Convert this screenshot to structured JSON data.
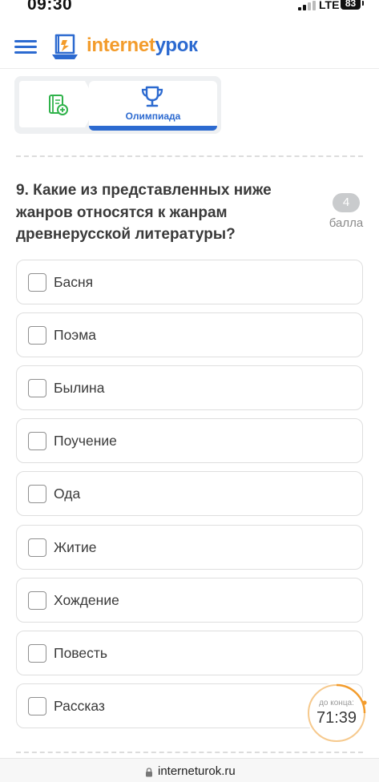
{
  "status_bar": {
    "time": "09:30",
    "network": "LTE",
    "battery": "83"
  },
  "header": {
    "logo_part1": "internet",
    "logo_part2": "урок"
  },
  "steps": {
    "active_label": "Олимпиада"
  },
  "question": {
    "text": "9. Какие из представленных ниже жанров относятся к жанрам древнерусской литературы?",
    "points_value": "4",
    "points_label": "балла"
  },
  "options": [
    {
      "label": "Басня",
      "checked": false
    },
    {
      "label": "Поэма",
      "checked": false
    },
    {
      "label": "Былина",
      "checked": false
    },
    {
      "label": "Поучение",
      "checked": false
    },
    {
      "label": "Ода",
      "checked": false
    },
    {
      "label": "Житие",
      "checked": false
    },
    {
      "label": "Хождение",
      "checked": false
    },
    {
      "label": "Повесть",
      "checked": false
    },
    {
      "label": "Рассказ",
      "checked": false
    }
  ],
  "timer": {
    "caption": "до конца:",
    "value": "71:39"
  },
  "url_bar": {
    "url": "interneturok.ru"
  },
  "colors": {
    "brand_blue": "#2c6ad0",
    "brand_orange": "#f39c2c",
    "step_green": "#2fb24a"
  },
  "icons": {
    "menu": "hamburger-icon",
    "logo": "book-laptop-icon",
    "step1": "textbook-plus-icon",
    "step2": "trophy-icon",
    "url": "lock-icon"
  }
}
